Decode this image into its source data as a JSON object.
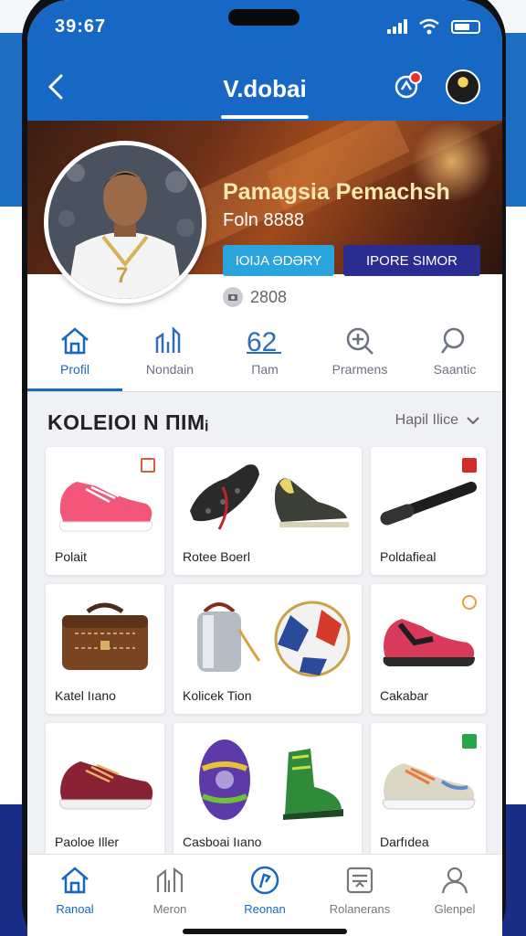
{
  "status": {
    "time": "39:67"
  },
  "header": {
    "title": "V.dobai"
  },
  "profile": {
    "name": "Pamagsia Pemachsh",
    "subline": "Foln 8888",
    "button_primary": "IOIJA ƏDƏRY",
    "button_secondary": "IPORE SIMOR",
    "followers": "2808"
  },
  "tabs": [
    {
      "label": "Profil",
      "icon": "home-icon",
      "active": true
    },
    {
      "label": "Nondain",
      "icon": "stats-icon",
      "active": false
    },
    {
      "label": "Πam",
      "icon": "numbers-icon",
      "active": false
    },
    {
      "label": "Prarmens",
      "icon": "zoom-icon",
      "active": false
    },
    {
      "label": "Saantic",
      "icon": "search-icon",
      "active": false
    }
  ],
  "collection": {
    "title": "KOLEIOI N ΠIMᵢ",
    "sort_label": "Hapil Ilice",
    "items": [
      {
        "caption": "Polait",
        "image": "pink-running-shoe",
        "tag_color": "#e05a3a"
      },
      {
        "caption": "Rotee Boerl",
        "image": "black-cleats",
        "tag_color": ""
      },
      {
        "caption": "Poldafieal",
        "image": "black-baton",
        "tag_color": "#d22c2c"
      },
      {
        "caption": "Katel Iıano",
        "image": "leather-bag",
        "tag_color": ""
      },
      {
        "caption": "Kolicek Tion",
        "image": "trophy-and-ball",
        "tag_color": ""
      },
      {
        "caption": "Cakabar",
        "image": "red-running-shoe",
        "tag_color": "#e0a040"
      },
      {
        "caption": "Paoloe Iller",
        "image": "maroon-sneaker",
        "tag_color": ""
      },
      {
        "caption": "Casboai Iıano",
        "image": "rugby-ball-and-boots",
        "tag_color": ""
      },
      {
        "caption": "Darfıdea",
        "image": "grey-running-shoe",
        "tag_color": "#2aa44a"
      }
    ]
  },
  "bottom_nav": [
    {
      "label": "Ranoal",
      "icon": "home-icon",
      "active": true
    },
    {
      "label": "Meron",
      "icon": "chart-icon",
      "active": false
    },
    {
      "label": "Reonan",
      "icon": "compass-icon",
      "active": false
    },
    {
      "label": "Rolanerans",
      "icon": "list-icon",
      "active": false
    },
    {
      "label": "Glenpel",
      "icon": "user-icon",
      "active": false
    }
  ],
  "colors": {
    "brand": "#1768c4",
    "accent_dark": "#2a2d8f",
    "accent_light": "#2aa4dc"
  }
}
